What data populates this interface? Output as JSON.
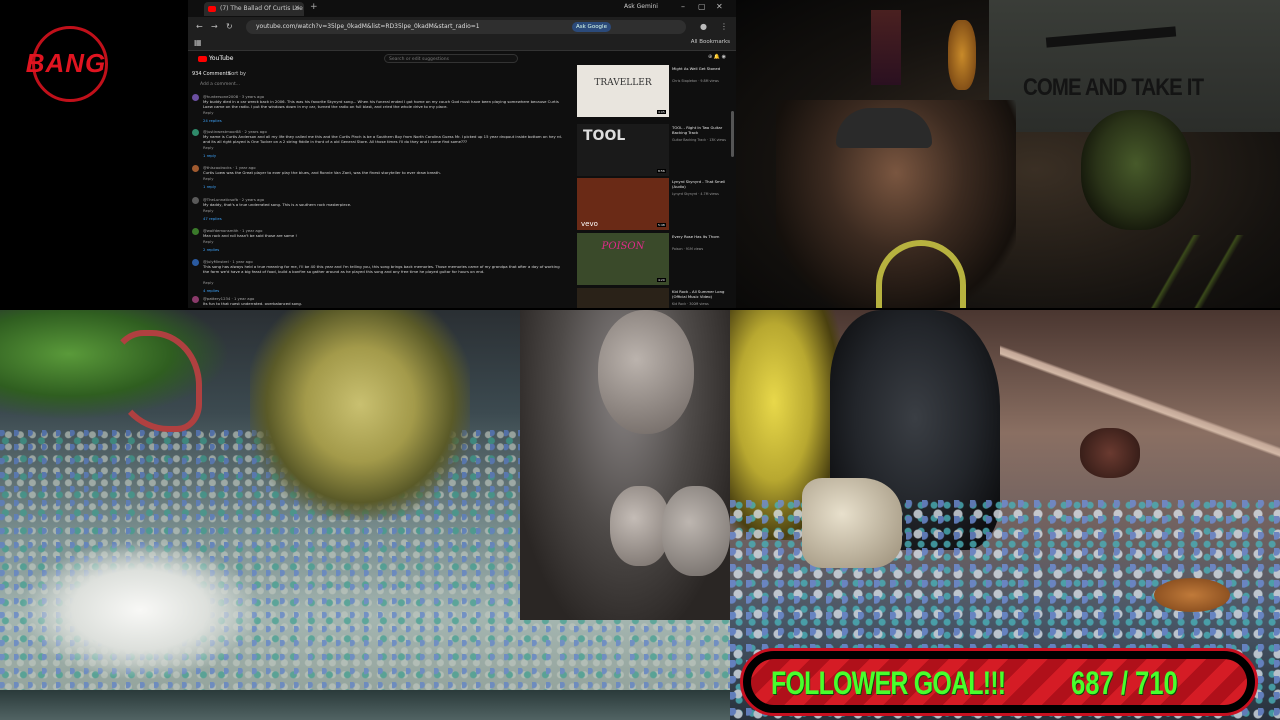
{
  "logo": {
    "text": "BANG"
  },
  "browser": {
    "tab_title": "(7) The Ballad Of Curtis Loe",
    "new_tab": "+",
    "ask_gemini": "Ask Gemini",
    "url": "youtube.com/watch?v=35lpe_0kadM&list=RD35lpe_0kadM&start_radio=1",
    "ask_google": "Ask Google",
    "all_bookmarks": "All Bookmarks",
    "youtube_label": "YouTube",
    "search_placeholder": "Search or edit suggestions",
    "comment_count": "934 Comments",
    "sort_by": "Sort by",
    "add_comment": "Add a comment...",
    "comments": [
      {
        "user": "@huntersone2008 · 3 years ago",
        "text": "My buddy died in a car wreck back in 2006. This was his favorite Skynyrd song...  When his funeral ended I got home on my couch God must have been playing somewhere because Curtis Loew came on the radio. I put the windows down in my car, turned the radio on full blast, and cried the whole drive to my place.",
        "likes": "",
        "replies": "24 replies"
      },
      {
        "user": "@justinwestmoor88 · 2 years ago",
        "text": "My name is Curtis Anderson and all my life they called me this and the Curtis Pinch is be a Southern Boy from North Carolina Guess Mr. I picked up 15 year dropout inside bottom on hey rd. and its all right played is One Tucker on a 2 string fiddle in front of a old General Store. All those times I'll do they and I come find some???",
        "likes": "",
        "replies": "1 reply"
      },
      {
        "user": "@thiscoolrocks · 1 year ago",
        "text": "Curtis Loew was the Great player to ever play the blues, and Ronnie Van Zant, was the finest storyteller to ever draw breath.",
        "likes": "",
        "replies": "1 reply"
      },
      {
        "user": "@TheLunnaticsofb · 2 years ago",
        "text": "My daddy, that's a true underrated song. This is a southern rock masterpiece.",
        "likes": "",
        "replies": "47 replies"
      },
      {
        "user": "@wolfdemonsmith · 1 year ago",
        "text": "Man rock and roll hasn't be said those are same ! ",
        "likes": "",
        "replies": "2 replies"
      },
      {
        "user": "@JulyMinstrel · 1 year ago",
        "text": "This song has always held a true meaning for me, I'll be 40 this year and I'm telling you, this song brings back memories. Those memories came of my grandpa that after a day of working the farm we'd have a big feast of food, build a bonfire so gather around as he played this song and any free time he played guitar for hours on end.",
        "likes": "",
        "replies": "4 replies"
      },
      {
        "user": "@pattery1234 · 1 year ago",
        "text": "Its fun to that ruest underrated. overbalanced song.",
        "likes": "",
        "replies": ""
      }
    ],
    "reply_label": "Reply",
    "suggestions": [
      {
        "title": "Might As Well Get Stoned",
        "meta": "Chris Stapleton · 9.8M views",
        "duration": "4:05",
        "thumb_text": "TRAVELLER",
        "thumb_bg": "#e9e5de",
        "thumb_fg": "#333333"
      },
      {
        "title": "TOOL - Right In Two Guitar Backing Track",
        "meta": "Guitar Backing Track · 13K views",
        "duration": "8:56",
        "thumb_text": "TOOL",
        "thumb_bg": "#1a1a1a",
        "thumb_fg": "#dddddd"
      },
      {
        "title": "Lynyrd Skynyrd - That Smell (Audio)",
        "meta": "Lynyrd Skynyrd · 4.7M views",
        "duration": "5:48",
        "thumb_text": "vevo",
        "thumb_bg": "#6a2a16",
        "thumb_fg": "#ffffff"
      },
      {
        "title": "Every Rose Has Its Thorn",
        "meta": "Poison · 91M views",
        "duration": "4:20",
        "thumb_text": "POISON",
        "thumb_bg": "#3a4a2a",
        "thumb_fg": "#e02a8a"
      },
      {
        "title": "Kid Rock - All Summer Long (Official Music Video)",
        "meta": "Kid Rock · 300M views",
        "duration": "4:59",
        "thumb_text": "",
        "thumb_bg": "#2a2218",
        "thumb_fg": "#ffffff"
      }
    ]
  },
  "webcam": {
    "flag_text": "COME AND TAKE IT"
  },
  "follower_goal": {
    "label": "FOLLOWER GOAL!!!",
    "current": "687",
    "separator": "/",
    "target": "710",
    "progress": 0.967
  }
}
